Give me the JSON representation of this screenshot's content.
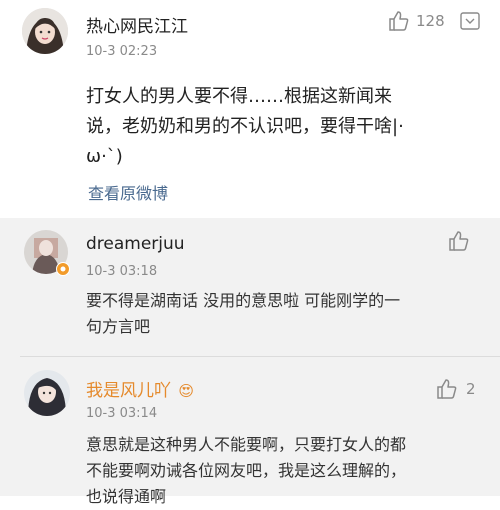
{
  "main_comment": {
    "username": "热心网民江江",
    "timestamp": "10-3 02:23",
    "likes": "128",
    "text_lines": [
      "打女人的男人要不得……根据这新闻来",
      "说，老奶奶和男的不认识吧，要得干啥|·",
      "ω·`)"
    ],
    "view_original_label": "查看原微博"
  },
  "replies": [
    {
      "username": "dreamerjuu",
      "timestamp": "10-3 03:18",
      "likes": "",
      "text_lines": [
        "要不得是湖南话 没用的意思啦 可能刚学的一",
        "句方言吧"
      ]
    },
    {
      "username": "我是风儿吖",
      "timestamp": "10-3 03:14",
      "likes": "2",
      "emoji": "😍",
      "text_lines": [
        "意思就是这种男人不能要啊，只要打女人的都",
        "不能要啊劝诫各位网友吧，我是这么理解的，",
        "也说得通啊"
      ]
    }
  ],
  "colors": {
    "link": "#4a6a8f",
    "username_highlight": "#e58a2c",
    "reply_bg": "#f2f2f2"
  },
  "icons": [
    "thumbs-up-icon",
    "more-options-icon",
    "avatar-badge-icon"
  ]
}
